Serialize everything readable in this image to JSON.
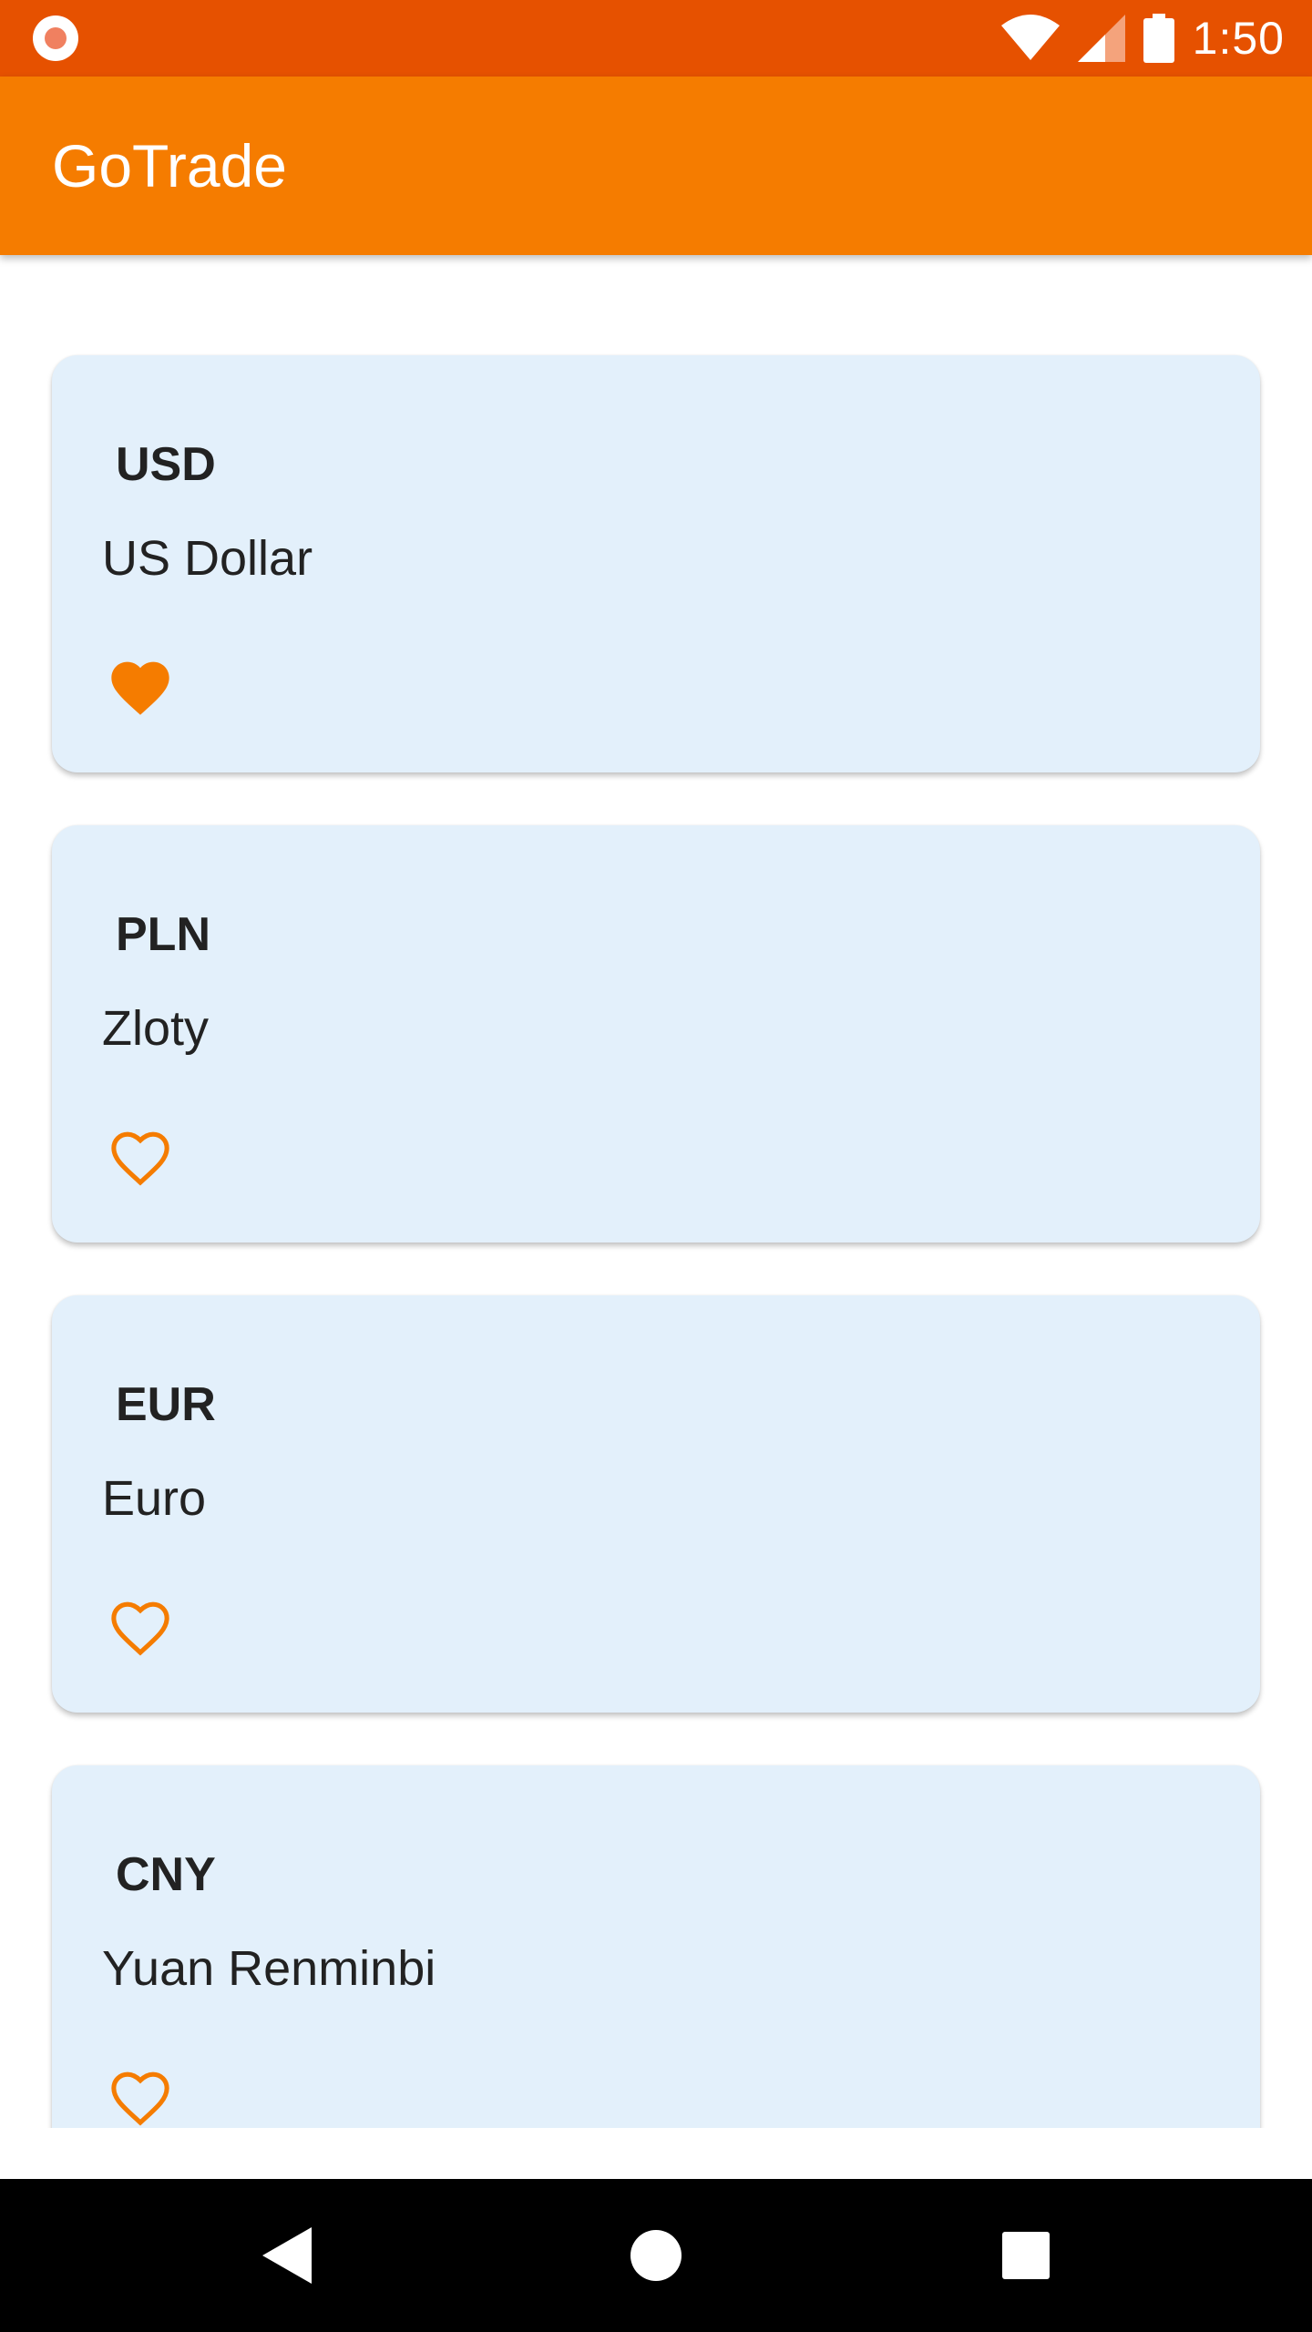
{
  "status_bar": {
    "time": "1:50"
  },
  "app_bar": {
    "title": "GoTrade"
  },
  "currencies": [
    {
      "code": "USD",
      "name": "US Dollar",
      "favorite": true
    },
    {
      "code": "PLN",
      "name": "Zloty",
      "favorite": false
    },
    {
      "code": "EUR",
      "name": "Euro",
      "favorite": false
    },
    {
      "code": "CNY",
      "name": "Yuan Renminbi",
      "favorite": false
    }
  ],
  "colors": {
    "status_bar": "#e65100",
    "app_bar": "#f57c00",
    "card_background": "#e3f0fb",
    "favorite_icon": "#f57c00"
  },
  "icons": {
    "favorite_filled": "heart-filled-icon",
    "favorite_outline": "heart-outline-icon",
    "back": "back-triangle-icon",
    "home": "home-circle-icon",
    "recents": "recents-square-icon"
  }
}
